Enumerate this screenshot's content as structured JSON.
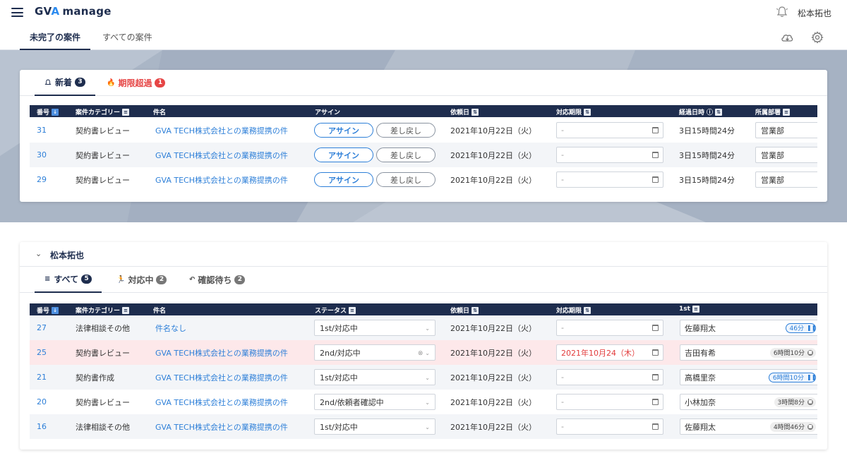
{
  "header": {
    "logo_gv": "GV",
    "logo_a": "A",
    "logo_manage": "manage",
    "user_name": "松本拓也"
  },
  "subnav": {
    "tabs": [
      "未完了の案件",
      "すべての案件"
    ]
  },
  "top_card": {
    "tabs": [
      {
        "label": "新着",
        "count": "3"
      },
      {
        "label": "期限超過",
        "count": "1"
      }
    ],
    "columns": [
      "番号",
      "案件カテゴリー",
      "件名",
      "アサイン",
      "依頼日",
      "対応期限",
      "経過日時",
      "所属部署"
    ],
    "assign_label": "アサイン",
    "return_label": "差し戻し",
    "rows": [
      {
        "id": "31",
        "category": "契約書レビュー",
        "title": "GVA TECH株式会社との業務提携の件",
        "date": "2021年10月22日（火）",
        "deadline": "-",
        "elapsed": "3日15時間24分",
        "dept": "営業部"
      },
      {
        "id": "30",
        "category": "契約書レビュー",
        "title": "GVA TECH株式会社との業務提携の件",
        "date": "2021年10月22日（火）",
        "deadline": "-",
        "elapsed": "3日15時間24分",
        "dept": "営業部"
      },
      {
        "id": "29",
        "category": "契約書レビュー",
        "title": "GVA TECH株式会社との業務提携の件",
        "date": "2021年10月22日（火）",
        "deadline": "-",
        "elapsed": "3日15時間24分",
        "dept": "営業部"
      }
    ]
  },
  "bottom_card": {
    "section_title": "松本拓也",
    "tabs": [
      {
        "label": "すべて",
        "count": "5"
      },
      {
        "label": "対応中",
        "count": "2"
      },
      {
        "label": "確認待ち",
        "count": "2"
      }
    ],
    "columns": [
      "番号",
      "案件カテゴリー",
      "件名",
      "ステータス",
      "依頼日",
      "対応期限",
      "1st"
    ],
    "rows": [
      {
        "id": "27",
        "category": "法律相談その他",
        "title": "件名なし",
        "status": "1st/対応中",
        "date": "2021年10月22日（火）",
        "deadline": "-",
        "person": "佐藤翔太",
        "timer": "46分",
        "timer_state": "running"
      },
      {
        "id": "25",
        "category": "契約書レビュー",
        "title": "GVA TECH株式会社との業務提携の件",
        "status": "2nd/対応中",
        "date": "2021年10月22日（火）",
        "deadline": "2021年10月24（木）",
        "person": "吉田有希",
        "timer": "6時間10分",
        "timer_state": "stopped"
      },
      {
        "id": "21",
        "category": "契約書作成",
        "title": "GVA TECH株式会社との業務提携の件",
        "status": "1st/対応中",
        "date": "2021年10月22日（火）",
        "deadline": "-",
        "person": "高橋里奈",
        "timer": "6時間10分",
        "timer_state": "running"
      },
      {
        "id": "20",
        "category": "契約書レビュー",
        "title": "GVA TECH株式会社との業務提携の件",
        "status": "2nd/依頼者確認中",
        "date": "2021年10月22日（火）",
        "deadline": "-",
        "person": "小林加奈",
        "timer": "3時間8分",
        "timer_state": "stopped"
      },
      {
        "id": "16",
        "category": "法律相談その他",
        "title": "GVA TECH株式会社との業務提携の件",
        "status": "1st/対応中",
        "date": "2021年10月22日（火）",
        "deadline": "-",
        "person": "佐藤翔太",
        "timer": "4時間46分",
        "timer_state": "stopped"
      }
    ]
  },
  "colors": {
    "navy": "#1e2d4e",
    "link": "#2d7fd8",
    "overdue_red": "#e64545",
    "banner": "#aab6c6",
    "warn_row": "#fde8ea"
  }
}
